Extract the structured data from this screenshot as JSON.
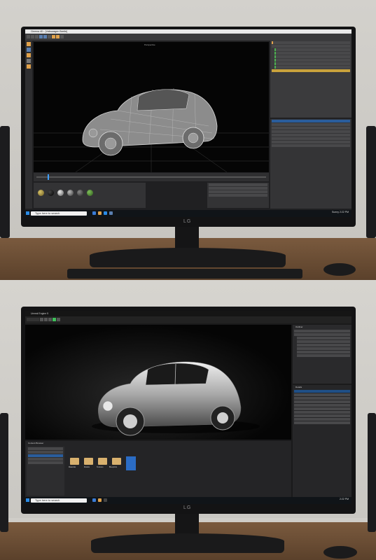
{
  "top_photo": {
    "app_title": "Cinema 4D - [Volkswagen Beetle]",
    "viewport_label": "Perspective",
    "taskbar": {
      "search_placeholder": "Type here to search",
      "weather": "Sunny",
      "time": "2:22 PM"
    },
    "monitor_brand": "LG"
  },
  "bottom_photo": {
    "app_title": "Unreal Engine 5",
    "content_browser_title": "Content Browser",
    "outliner_title": "Outliner",
    "details_title": "Details",
    "folders": [
      "Materials",
      "Models",
      "Textures",
      "Blueprints"
    ],
    "taskbar": {
      "search_placeholder": "Type here to search",
      "time": "2:22 PM"
    },
    "monitor_brand": "LG"
  },
  "colors": {
    "wall": "#cfcdc8",
    "desk": "#6b4c33",
    "monitor_bezel": "#131314",
    "ui_panel": "#3b3b3d",
    "accent_blue": "#2b8be6",
    "accent_orange": "#e0a14a"
  }
}
